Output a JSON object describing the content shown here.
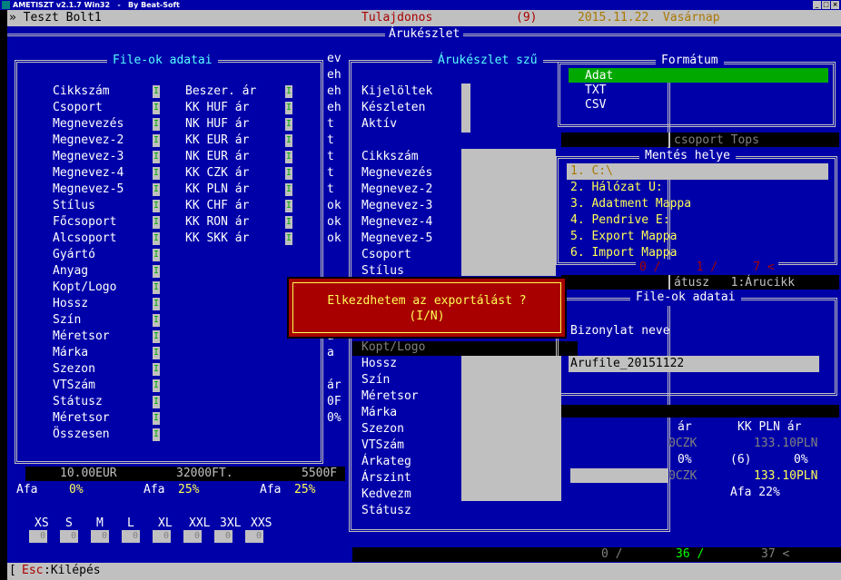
{
  "window": {
    "title": "AMETISZT v2.1.7 Win32   -   By Beat-Soft",
    "controls": [
      "_",
      "□",
      "×"
    ]
  },
  "topbar": {
    "shop": "» Teszt Bolt1",
    "owner": "Tulajdonos",
    "code": "(9)",
    "date": "2015.11.22. Vasárnap"
  },
  "main": {
    "title": "Árukészlet"
  },
  "files_panel": {
    "title": "File-ok adatai",
    "left_fields": [
      "Cikkszám",
      "Csoport",
      "Megnevezés",
      "Megnevez-2",
      "Megnevez-3",
      "Megnevez-4",
      "Megnevez-5",
      "Stílus",
      "Főcsoport",
      "Alcsoport",
      "Gyártó",
      "Anyag",
      "Kopt/Logo",
      "Hossz",
      "Szín",
      "Méretsor",
      "Márka",
      "Szezon",
      "VTSzám",
      "Státusz",
      "Méretsor",
      "Összesen"
    ],
    "mid_fields": [
      "Beszer. ár",
      "KK HUF ár",
      "NK HUF ár",
      "KK EUR ár",
      "NK EUR ár",
      "KK CZK ár",
      "KK PLN ár",
      "KK CHF ár",
      "KK RON ár",
      "KK SKK ár"
    ],
    "indicator": "I"
  },
  "stock_panel": {
    "title": "Árukészlet szű",
    "flags": [
      "Kijelöltek",
      "Készleten",
      "Aktív"
    ],
    "fields": [
      "Cikkszám",
      "Megnevezés",
      "Megnevez-2",
      "Megnevez-3",
      "Megnevez-4",
      "Megnevez-5",
      "Csoport",
      "Stílus"
    ],
    "fields_lower": [
      "Kopt/Logo",
      "Hossz",
      "Szín",
      "Méretsor",
      "Márka",
      "Szezon",
      "VTSzám",
      "Árkateg",
      "Árszint",
      "Kedvezm",
      "Státusz"
    ]
  },
  "totals": {
    "eur": "10.00EUR",
    "ft": "32000FT.",
    "chf": "5500F",
    "afa1": "Afa",
    "afa1v": "0%",
    "afa2": "Afa",
    "afa2v": "25%",
    "afa3": "Afa",
    "afa3v": "25%"
  },
  "sizes": {
    "labels": [
      "XS",
      "S",
      "M",
      "L",
      "XL",
      "XXL",
      "3XL",
      "XXS"
    ],
    "values": [
      "0",
      "0",
      "0",
      "0",
      "0",
      "0",
      "0",
      "0"
    ]
  },
  "partial_col": [
    "ev",
    "eh",
    "eh",
    "eh",
    "t",
    "t",
    "t",
    "t",
    "t",
    "ok",
    "ok",
    "ok",
    "",
    "",
    "",
    "t",
    "a",
    "a",
    "a",
    "",
    "ár",
    "0F",
    "0%"
  ],
  "format_panel": {
    "title": "Formátum",
    "options": [
      "Adat",
      "TXT",
      "CSV"
    ],
    "selected": 0
  },
  "group_bar": "csoport Tops",
  "save_panel": {
    "title": "Mentés helye",
    "items": [
      "1. C:\\",
      "2. Hálózat U:",
      "3. Adatment Mappa",
      "4. Pendrive E:",
      "5. Export Mappa",
      "6. Import Mappa"
    ],
    "selected": 0,
    "status": "0 /     1 /     7 <"
  },
  "status_line": "átusz   1:Árucikk",
  "file_panel2": {
    "title": "File-ok adatai",
    "label": "Bizonylat neve",
    "filename": "Arufile_20151122"
  },
  "right_prices": {
    "col1": "ár",
    "col2": "KK PLN ár",
    "czk1": "0CZK",
    "pln1": "133.10PLN",
    "pct1": "0%",
    "code": "(6)",
    "pct2": "0%",
    "czk2": "0CZK",
    "pln2": "133.10PLN",
    "afa": "Afa 22%"
  },
  "dialog": {
    "line1": "Elkezdhetem az exportálást ?",
    "line2": "(I/N)"
  },
  "bottom_counters": {
    "c1": "0 /",
    "c2": "36 /",
    "c3": "37 <"
  },
  "bottombar": {
    "key": "Esc",
    "label": ":Kilépés"
  }
}
